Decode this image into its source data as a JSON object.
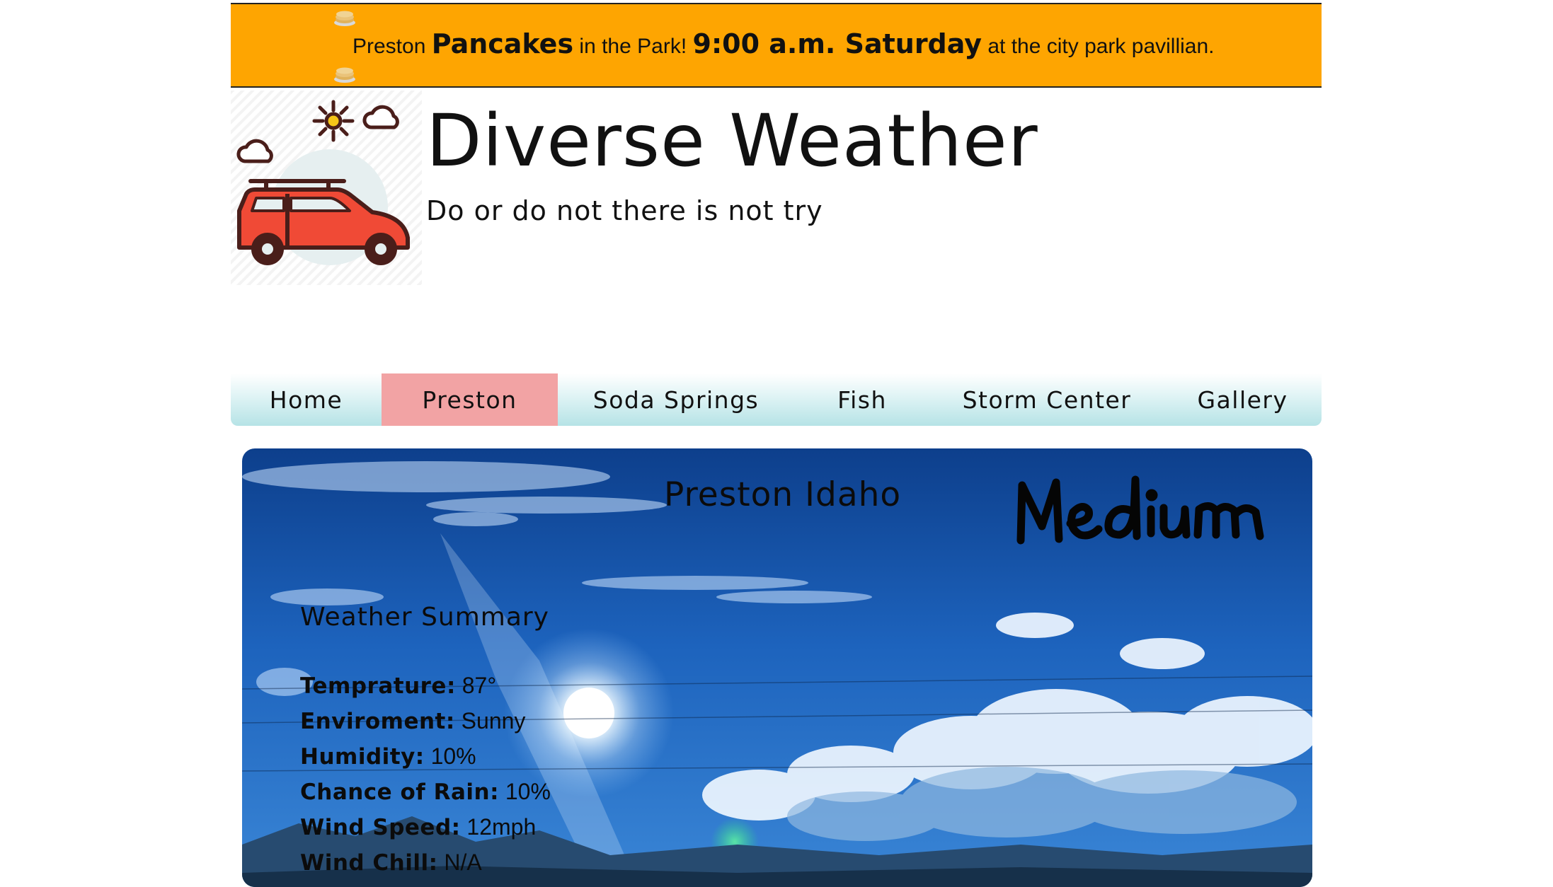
{
  "banner": {
    "text_1": "Preston ",
    "text_2": "Pancakes",
    "text_3": " in the Park! ",
    "text_4": "9:00 a.m. Saturday",
    "text_5": " at the city park pavillian."
  },
  "header": {
    "title": "Diverse Weather",
    "tagline": "Do or do not there is not try"
  },
  "nav": {
    "items": [
      {
        "label": "Home"
      },
      {
        "label": "Preston"
      },
      {
        "label": "Soda Springs"
      },
      {
        "label": "Fish"
      },
      {
        "label": "Storm Center"
      },
      {
        "label": "Gallery"
      }
    ],
    "active": "Preston"
  },
  "hero": {
    "title": "Preston Idaho",
    "badge": "Medium"
  },
  "summary": {
    "heading": "Weather Summary",
    "items": [
      {
        "label": "Temprature:",
        "value": " 87°"
      },
      {
        "label": "Enviroment:",
        "value": " Sunny"
      },
      {
        "label": "Humidity:",
        "value": " 10%"
      },
      {
        "label": "Chance of Rain:",
        "value": " 10%"
      },
      {
        "label": "Wind Speed:",
        "value": " 12mph"
      },
      {
        "label": "Wind Chill:",
        "value": " N/A"
      }
    ]
  },
  "colors": {
    "banner": "#fea501",
    "nav_active": "#f2a3a4",
    "nav_gradient_bottom": "#b6e3e6",
    "car_body": "#f04a36",
    "sky": "#1f5fb4"
  },
  "icons": [
    "pancake-icon",
    "sun-icon",
    "cloud-icon",
    "car-icon"
  ]
}
